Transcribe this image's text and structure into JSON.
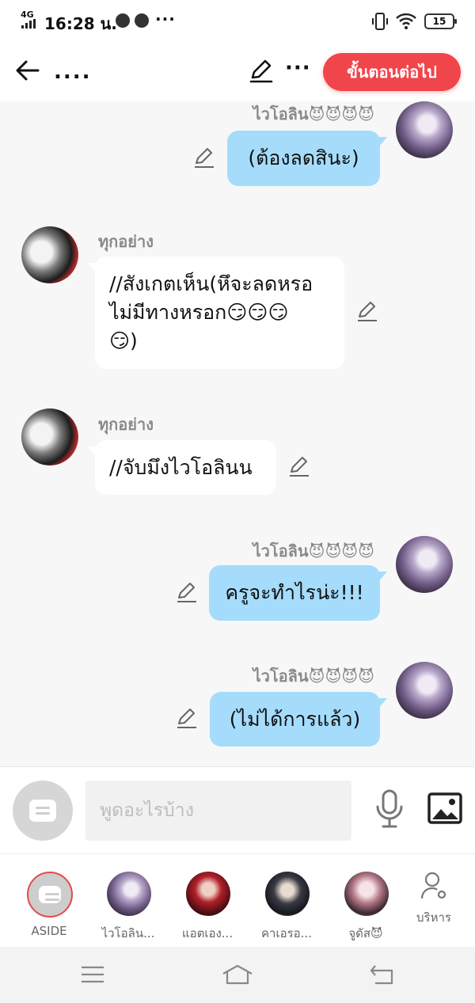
{
  "status": {
    "network": "4G",
    "time": "16:28 น.",
    "more": "···",
    "battery": "15"
  },
  "header": {
    "title": "....",
    "more": "···",
    "next_label": "ขั้นตอนต่อไป"
  },
  "messages": [
    {
      "side": "right",
      "name": "ไวโอลิน😈😈😈😈",
      "text": "(ต้องลดสินะ)"
    },
    {
      "side": "left",
      "name": "ทุกอย่าง",
      "text": "//สังเกตเห็น(หึจะลดหรอ\nไม่มีทางหรอก😏😏😏\n😏)"
    },
    {
      "side": "left",
      "name": "ทุกอย่าง",
      "text": "//จับมึงไวโอลินน"
    },
    {
      "side": "right",
      "name": "ไวโอลิน😈😈😈😈",
      "text": "ครูจะทำไรน่ะ!!!"
    },
    {
      "side": "right",
      "name": "ไวโอลิน😈😈😈😈",
      "text": "(ไม่ได้การแล้ว)"
    }
  ],
  "input": {
    "placeholder": "พูดอะไรบ้าง"
  },
  "characters": [
    {
      "label": "ASIDE"
    },
    {
      "label": "ไวโอลิน..."
    },
    {
      "label": "แอตเอง..."
    },
    {
      "label": "คาเอรอ..."
    },
    {
      "label": "จูดัส😈"
    }
  ],
  "admin_label": "บริหาร",
  "icons": {
    "back": "arrow-left-icon",
    "edit": "pencil-icon",
    "mic": "microphone-icon",
    "image": "image-icon",
    "admin": "user-gear-icon"
  },
  "colors": {
    "accent": "#f1454c",
    "my_bubble": "#a5dcfb",
    "their_bubble": "#ffffff"
  }
}
